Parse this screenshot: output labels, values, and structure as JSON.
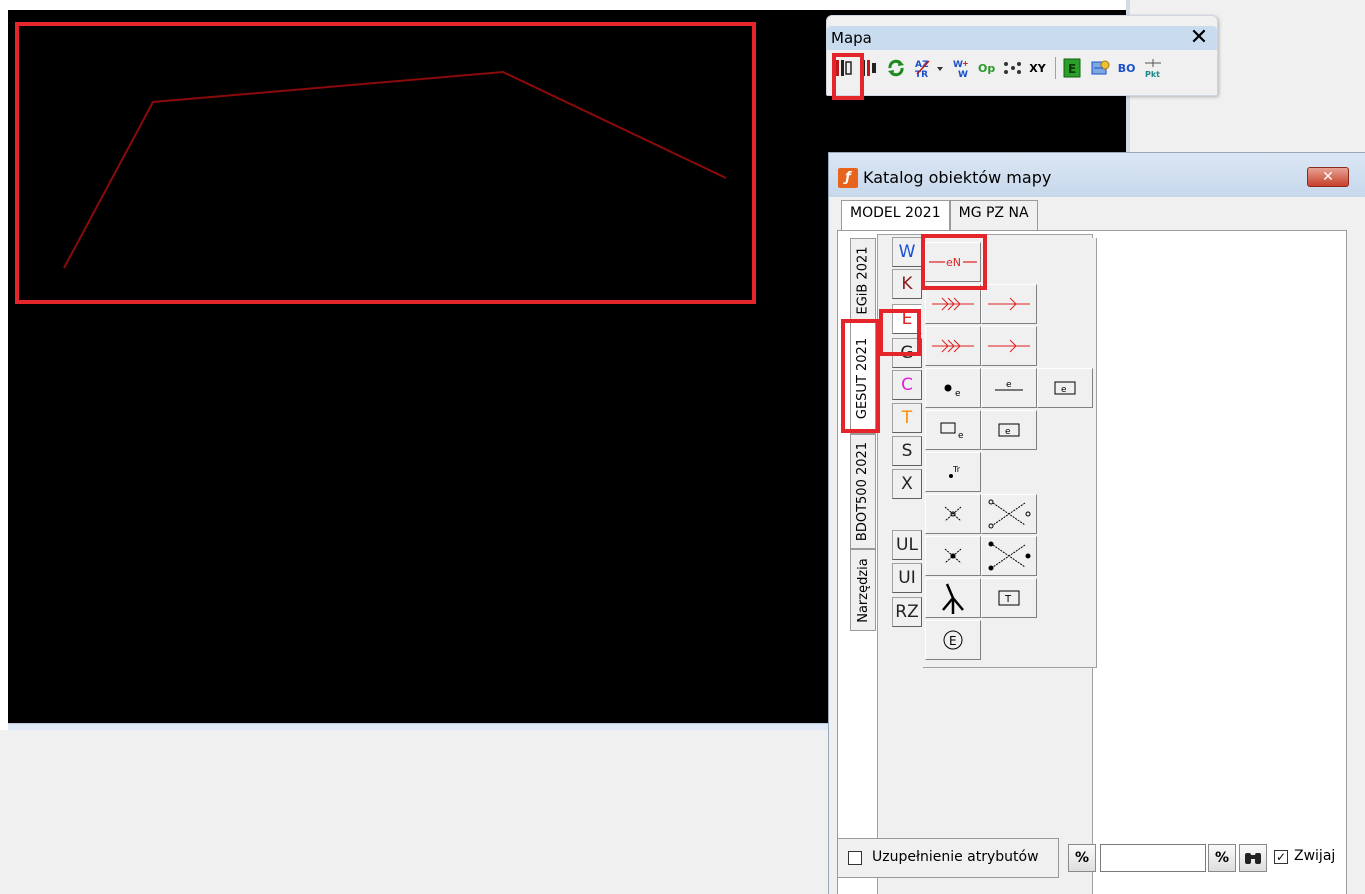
{
  "mapa_toolbar": {
    "title": "Mapa",
    "close_label": "✕",
    "tools": [
      {
        "name": "select-objects-tool",
        "label": "",
        "color": "#b01010"
      },
      {
        "name": "layers-tool",
        "label": "",
        "color": "#333333"
      },
      {
        "name": "refresh-tool",
        "label": "",
        "color": "#1a8a1a"
      },
      {
        "name": "az-text-tool",
        "label": "",
        "color": "#1a50c8"
      },
      {
        "name": "w-tool",
        "label": "",
        "color": "#1a50c8"
      },
      {
        "name": "op-tool",
        "label": "Op",
        "color": "#2a9a2a"
      },
      {
        "name": "points-tool",
        "label": "",
        "color": "#333333"
      },
      {
        "name": "xy-tool",
        "label": "XY",
        "color": "#111111"
      },
      {
        "name": "e-tool",
        "label": "",
        "color": "#1a9a1a"
      },
      {
        "name": "key-tool",
        "label": "",
        "color": "#1a50c8"
      },
      {
        "name": "bo-tool",
        "label": "BO",
        "color": "#1a50c8"
      },
      {
        "name": "pkt-tool",
        "label": "",
        "color": "#555555"
      }
    ]
  },
  "katalog": {
    "title": "Katalog obiektów mapy",
    "close_label": "✕",
    "top_tabs": [
      "MODEL 2021",
      "MG PZ NA"
    ],
    "vertical_tabs": [
      "EGiB 2021",
      "GESUT 2021",
      "BDOT500 2021",
      "Narzędzia"
    ],
    "categories": [
      {
        "label": "W",
        "color": "#1a4fd6"
      },
      {
        "label": "K",
        "color": "#8b1a1a"
      },
      {
        "label": "E",
        "color": "#e02020"
      },
      {
        "label": "G",
        "color": "#222222"
      },
      {
        "label": "C",
        "color": "#e020e0"
      },
      {
        "label": "T",
        "color": "#ff8c00"
      },
      {
        "label": "S",
        "color": "#222222"
      },
      {
        "label": "X",
        "color": "#222222"
      },
      {
        "label": "UL",
        "color": "#222222"
      },
      {
        "label": "UI",
        "color": "#222222"
      },
      {
        "label": "RZ",
        "color": "#222222"
      }
    ],
    "symbol_labels": {
      "en_line": "eN",
      "e_small": "e",
      "tr_point": "Tr",
      "t_box": "T",
      "e_circle": "E"
    },
    "footer": {
      "checkbox_label": "Uzupełnienie atrybutów",
      "percent_label": "%",
      "search_value": "",
      "zwijaj_label": "Zwijaj",
      "zwijaj_checked": "✓"
    }
  },
  "colors": {
    "highlight": "#e5252c",
    "polyline": "#8b0a0a",
    "canvas": "#000000"
  }
}
